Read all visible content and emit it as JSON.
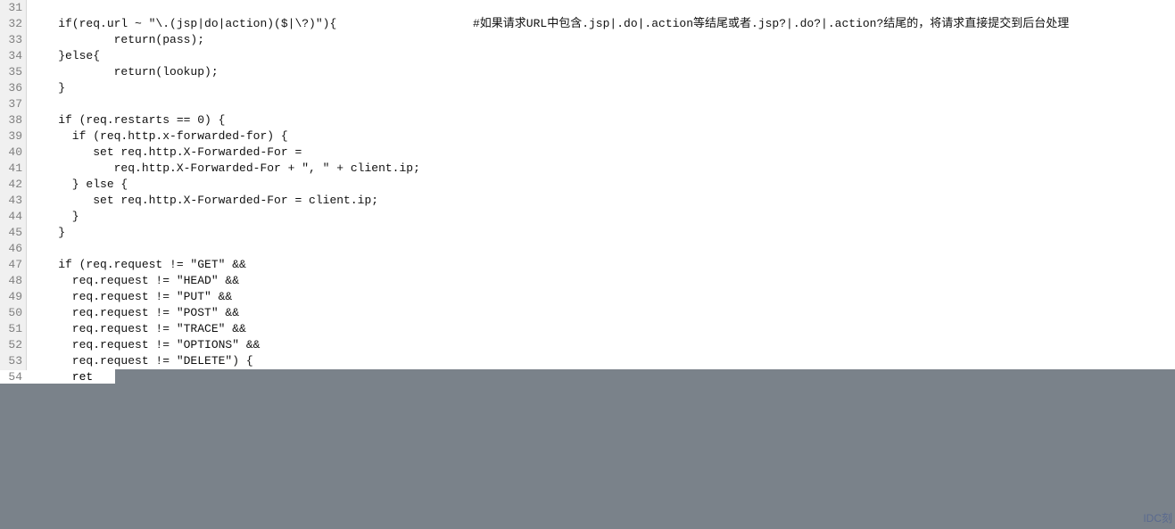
{
  "gutter": {
    "start": 31,
    "end": 54
  },
  "lines": {
    "l31": "",
    "l32_code": "    if(req.url ~ \"\\.(jsp|do|action)($|\\?)\"){",
    "l32_comment": "#如果请求URL中包含.jsp|.do|.action等结尾或者.jsp?|.do?|.action?结尾的，将请求直接提交到后台处理",
    "l33": "            return(pass);",
    "l34": "    }else{",
    "l35": "            return(lookup);",
    "l36": "    }",
    "l37": "",
    "l38": "    if (req.restarts == 0) {",
    "l39": "      if (req.http.x-forwarded-for) {",
    "l40": "         set req.http.X-Forwarded-For =",
    "l41": "            req.http.X-Forwarded-For + \", \" + client.ip;",
    "l42": "      } else {",
    "l43": "         set req.http.X-Forwarded-For = client.ip;",
    "l44": "      }",
    "l45": "    }",
    "l46": "",
    "l47": "    if (req.request != \"GET\" &&",
    "l48": "      req.request != \"HEAD\" &&",
    "l49": "      req.request != \"PUT\" &&",
    "l50": "      req.request != \"POST\" &&",
    "l51": "      req.request != \"TRACE\" &&",
    "l52": "      req.request != \"OPTIONS\" &&",
    "l53": "      req.request != \"DELETE\") {",
    "l54": "      ret"
  },
  "watermark": "IDC刻"
}
